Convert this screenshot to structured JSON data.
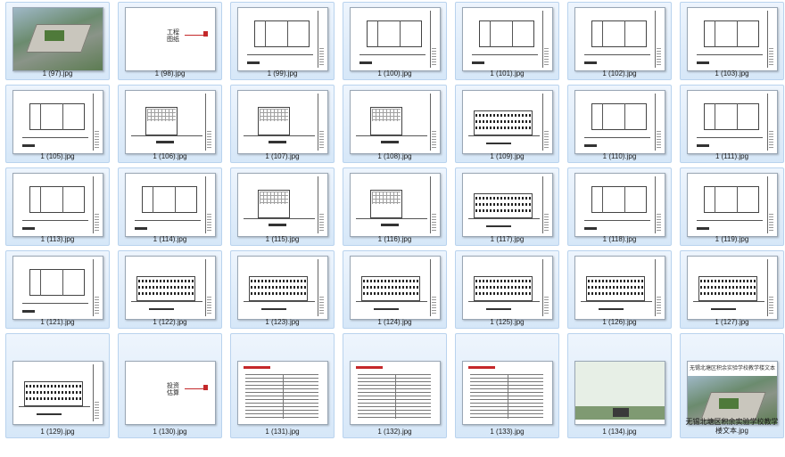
{
  "files": [
    {
      "name": "1 (97).jpg",
      "kind": "photo"
    },
    {
      "name": "1 (98).jpg",
      "kind": "cover",
      "cover_text": "工程\n图纸"
    },
    {
      "name": "1 (99).jpg",
      "kind": "plan"
    },
    {
      "name": "1 (100).jpg",
      "kind": "plan"
    },
    {
      "name": "1 (101).jpg",
      "kind": "plan"
    },
    {
      "name": "1 (102).jpg",
      "kind": "plan"
    },
    {
      "name": "1 (103).jpg",
      "kind": "plan"
    },
    {
      "name": "1 (105).jpg",
      "kind": "plan"
    },
    {
      "name": "1 (106).jpg",
      "kind": "section"
    },
    {
      "name": "1 (107).jpg",
      "kind": "section"
    },
    {
      "name": "1 (108).jpg",
      "kind": "section"
    },
    {
      "name": "1 (109).jpg",
      "kind": "elevation"
    },
    {
      "name": "1 (110).jpg",
      "kind": "plan"
    },
    {
      "name": "1 (111).jpg",
      "kind": "plan"
    },
    {
      "name": "1 (113).jpg",
      "kind": "plan"
    },
    {
      "name": "1 (114).jpg",
      "kind": "plan"
    },
    {
      "name": "1 (115).jpg",
      "kind": "section"
    },
    {
      "name": "1 (116).jpg",
      "kind": "section"
    },
    {
      "name": "1 (117).jpg",
      "kind": "elevation"
    },
    {
      "name": "1 (118).jpg",
      "kind": "plan"
    },
    {
      "name": "1 (119).jpg",
      "kind": "plan"
    },
    {
      "name": "1 (121).jpg",
      "kind": "plan"
    },
    {
      "name": "1 (122).jpg",
      "kind": "elevation"
    },
    {
      "name": "1 (123).jpg",
      "kind": "elevation"
    },
    {
      "name": "1 (124).jpg",
      "kind": "elevation"
    },
    {
      "name": "1 (125).jpg",
      "kind": "elevation"
    },
    {
      "name": "1 (126).jpg",
      "kind": "elevation"
    },
    {
      "name": "1 (127).jpg",
      "kind": "elevation"
    },
    {
      "name": "1 (129).jpg",
      "kind": "elevation"
    },
    {
      "name": "1 (130).jpg",
      "kind": "cover",
      "cover_text": "投资\n估算"
    },
    {
      "name": "1 (131).jpg",
      "kind": "table"
    },
    {
      "name": "1 (132).jpg",
      "kind": "table"
    },
    {
      "name": "1 (133).jpg",
      "kind": "table"
    },
    {
      "name": "1 (134).jpg",
      "kind": "photo-flat"
    },
    {
      "name": "无锡北塘区积余实验学校教学楼文本.jpg",
      "kind": "aerial",
      "header_text": "无锡北塘区积余实验学校教学楼文本"
    }
  ],
  "colors": {
    "tile_bg": "#d6e7f8",
    "tile_border": "#b9d3ee",
    "accent_red": "#c4282a"
  }
}
